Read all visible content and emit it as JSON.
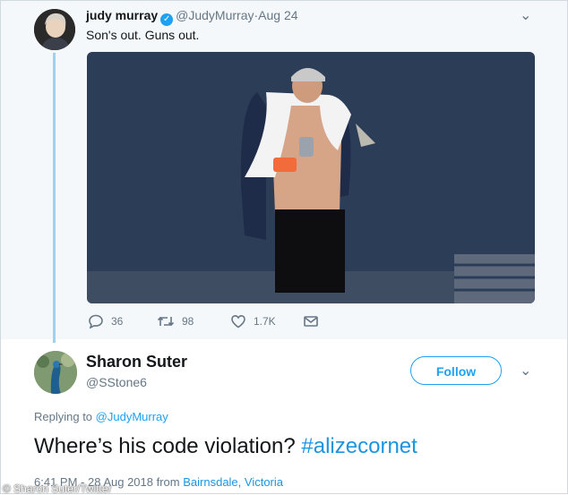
{
  "original_tweet": {
    "display_name": "judy murray",
    "handle": "@JudyMurray",
    "date": "·Aug 24",
    "text": "Son's out. Guns out.",
    "photo_icon": "tennis-player-photo",
    "counts": {
      "replies": "36",
      "retweets": "98",
      "likes": "1.7K"
    }
  },
  "reply_tweet": {
    "display_name": "Sharon Suter",
    "handle": "@SStone6",
    "follow_label": "Follow",
    "replying_prefix": "Replying to",
    "replying_handle": "@JudyMurray",
    "text_main": "Where’s his code violation?",
    "hashtag": "#alizecornet",
    "timestamp": "6:41 PM - 28 Aug 2018",
    "from_label": "from",
    "location": "Bairnsdale, Victoria"
  },
  "watermark": "© Sharon Suter/Twitter",
  "colors": {
    "accent": "#1da1f2",
    "muted": "#657786",
    "thread": "#9ed2f2"
  }
}
